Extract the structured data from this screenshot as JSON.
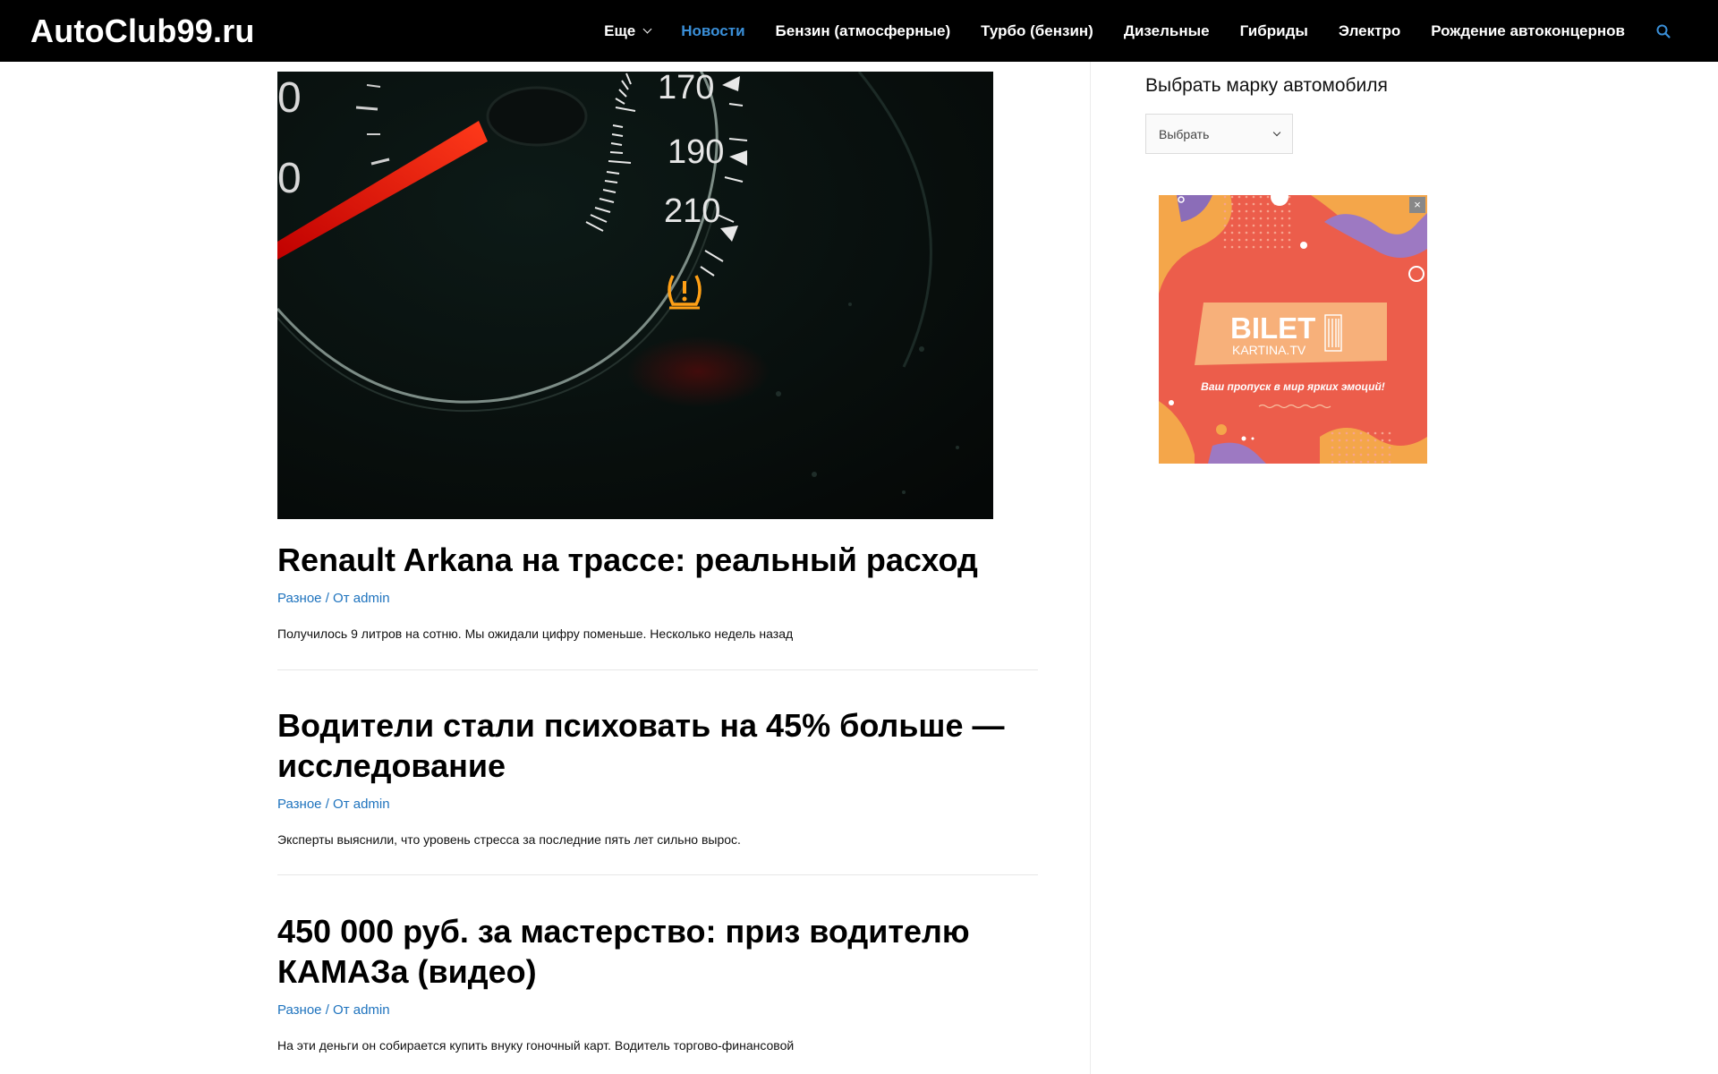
{
  "site": {
    "logo": "AutoClub99.ru"
  },
  "nav": {
    "items": [
      {
        "label": "Еще",
        "has_dropdown": true,
        "active": false
      },
      {
        "label": "Новости",
        "active": true
      },
      {
        "label": "Бензин (атмосферные)",
        "active": false
      },
      {
        "label": "Турбо (бензин)",
        "active": false
      },
      {
        "label": "Дизельные",
        "active": false
      },
      {
        "label": "Гибриды",
        "active": false
      },
      {
        "label": "Электро",
        "active": false
      },
      {
        "label": "Рождение автоконцернов",
        "active": false
      }
    ],
    "search_icon": "search-icon"
  },
  "hero": {
    "gauge_labels": [
      "170",
      "190",
      "210"
    ]
  },
  "posts": [
    {
      "title": "Renault Arkana на трассе: реальный расход",
      "category": "Разное",
      "separator": " / От ",
      "author": "admin",
      "excerpt": "Получилось 9 литров на сотню. Мы ожидали цифру поменьше. Несколько недель назад"
    },
    {
      "title": "Водители стали психовать на 45% больше — исследование",
      "category": "Разное",
      "separator": " / От ",
      "author": "admin",
      "excerpt": "Эксперты выяснили, что уровень стресса за последние пять лет сильно вырос."
    },
    {
      "title": "450 000 руб. за мастерство: приз водителю КАМАЗа (видео)",
      "category": "Разное",
      "separator": " / От ",
      "author": "admin",
      "excerpt": "На эти деньги он собирается купить внуку гоночный карт. Водитель торгово-финансовой"
    }
  ],
  "sidebar": {
    "widget_title": "Выбрать марку автомобиля",
    "select_value": "Выбрать"
  },
  "ad": {
    "brand": "BILET",
    "sub": "KARTINA.TV",
    "tagline": "Ваш пропуск в мир ярких эмоций!",
    "close": "×"
  },
  "colors": {
    "header_bg": "#000000",
    "nav_active": "#3a8fd8",
    "link": "#1e73be"
  }
}
